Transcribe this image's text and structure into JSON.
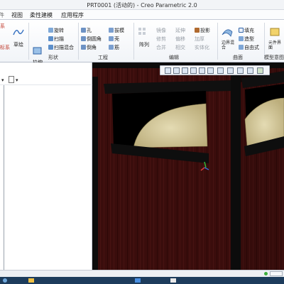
{
  "window": {
    "title": "PRT0001 (活动的) - Creo Parametric 2.0"
  },
  "tabs": [
    "视图",
    "柔性建模",
    "应用程序"
  ],
  "ribbon": {
    "left_fragment": "系",
    "left_item": "标系",
    "sketch": "草绘",
    "extrude": "拉伸",
    "revolve": "旋转",
    "sweep": "扫描",
    "sweep_blend": "扫描混合",
    "hole": "孔",
    "round": "倒圆角",
    "chamfer": "倒角",
    "draft": "拔模",
    "shell": "壳",
    "rib": "筋",
    "pattern": "阵列",
    "mirror": "镜像",
    "trim": "修剪",
    "merge": "合并",
    "extend": "延伸",
    "offset": "偏移",
    "intersect": "相交",
    "project": "投影",
    "thicken": "加厚",
    "solidify": "实体化",
    "boundary_blend": "边界混合",
    "fill": "填充",
    "style": "造型",
    "freestyle": "自由式",
    "model_view_btn": "元件界面",
    "groups": {
      "shape": "形状",
      "engineering": "工程",
      "editing": "编辑",
      "surfaces": "曲面",
      "model_intent": "模型意图"
    }
  },
  "icons": [
    "sketch-icon",
    "extrude-icon",
    "revolve-icon",
    "hole-icon",
    "pattern-icon",
    "boundary-blend-icon",
    "fill-icon"
  ],
  "colors": {
    "wood": "#3a0d0c",
    "frame": "#0d0d0d",
    "surface": "#d9cfa6",
    "accent": "#3a74c2"
  }
}
